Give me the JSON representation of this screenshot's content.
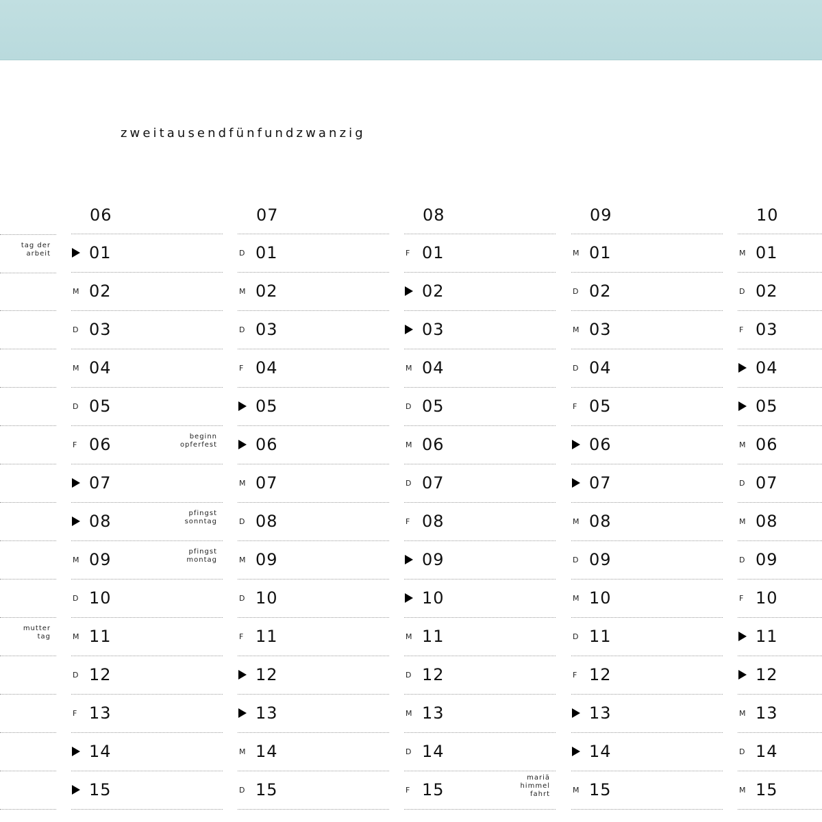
{
  "title": "zweitausendfünfundzwanzig",
  "left_column_notes": [
    "tag der\narbeit",
    "",
    "",
    "",
    "",
    "",
    "",
    "",
    "",
    "",
    "mutter\ntag",
    "",
    "",
    "",
    ""
  ],
  "months": [
    {
      "label": "06",
      "days": [
        {
          "wd": "▶",
          "num": "01",
          "note": ""
        },
        {
          "wd": "M",
          "num": "02",
          "note": ""
        },
        {
          "wd": "D",
          "num": "03",
          "note": ""
        },
        {
          "wd": "M",
          "num": "04",
          "note": ""
        },
        {
          "wd": "D",
          "num": "05",
          "note": ""
        },
        {
          "wd": "F",
          "num": "06",
          "note": "beginn\nopferfest"
        },
        {
          "wd": "▶",
          "num": "07",
          "note": ""
        },
        {
          "wd": "▶",
          "num": "08",
          "note": "pfingst\nsonntag"
        },
        {
          "wd": "M",
          "num": "09",
          "note": "pfingst\nmontag"
        },
        {
          "wd": "D",
          "num": "10",
          "note": ""
        },
        {
          "wd": "M",
          "num": "11",
          "note": ""
        },
        {
          "wd": "D",
          "num": "12",
          "note": ""
        },
        {
          "wd": "F",
          "num": "13",
          "note": ""
        },
        {
          "wd": "▶",
          "num": "14",
          "note": ""
        },
        {
          "wd": "▶",
          "num": "15",
          "note": ""
        }
      ]
    },
    {
      "label": "07",
      "days": [
        {
          "wd": "D",
          "num": "01",
          "note": ""
        },
        {
          "wd": "M",
          "num": "02",
          "note": ""
        },
        {
          "wd": "D",
          "num": "03",
          "note": ""
        },
        {
          "wd": "F",
          "num": "04",
          "note": ""
        },
        {
          "wd": "▶",
          "num": "05",
          "note": ""
        },
        {
          "wd": "▶",
          "num": "06",
          "note": ""
        },
        {
          "wd": "M",
          "num": "07",
          "note": ""
        },
        {
          "wd": "D",
          "num": "08",
          "note": ""
        },
        {
          "wd": "M",
          "num": "09",
          "note": ""
        },
        {
          "wd": "D",
          "num": "10",
          "note": ""
        },
        {
          "wd": "F",
          "num": "11",
          "note": ""
        },
        {
          "wd": "▶",
          "num": "12",
          "note": ""
        },
        {
          "wd": "▶",
          "num": "13",
          "note": ""
        },
        {
          "wd": "M",
          "num": "14",
          "note": ""
        },
        {
          "wd": "D",
          "num": "15",
          "note": ""
        }
      ]
    },
    {
      "label": "08",
      "days": [
        {
          "wd": "F",
          "num": "01",
          "note": ""
        },
        {
          "wd": "▶",
          "num": "02",
          "note": ""
        },
        {
          "wd": "▶",
          "num": "03",
          "note": ""
        },
        {
          "wd": "M",
          "num": "04",
          "note": ""
        },
        {
          "wd": "D",
          "num": "05",
          "note": ""
        },
        {
          "wd": "M",
          "num": "06",
          "note": ""
        },
        {
          "wd": "D",
          "num": "07",
          "note": ""
        },
        {
          "wd": "F",
          "num": "08",
          "note": ""
        },
        {
          "wd": "▶",
          "num": "09",
          "note": ""
        },
        {
          "wd": "▶",
          "num": "10",
          "note": ""
        },
        {
          "wd": "M",
          "num": "11",
          "note": ""
        },
        {
          "wd": "D",
          "num": "12",
          "note": ""
        },
        {
          "wd": "M",
          "num": "13",
          "note": ""
        },
        {
          "wd": "D",
          "num": "14",
          "note": ""
        },
        {
          "wd": "F",
          "num": "15",
          "note": "mariä\nhimmel\nfahrt"
        }
      ]
    },
    {
      "label": "09",
      "days": [
        {
          "wd": "M",
          "num": "01",
          "note": ""
        },
        {
          "wd": "D",
          "num": "02",
          "note": ""
        },
        {
          "wd": "M",
          "num": "03",
          "note": ""
        },
        {
          "wd": "D",
          "num": "04",
          "note": ""
        },
        {
          "wd": "F",
          "num": "05",
          "note": ""
        },
        {
          "wd": "▶",
          "num": "06",
          "note": ""
        },
        {
          "wd": "▶",
          "num": "07",
          "note": ""
        },
        {
          "wd": "M",
          "num": "08",
          "note": ""
        },
        {
          "wd": "D",
          "num": "09",
          "note": ""
        },
        {
          "wd": "M",
          "num": "10",
          "note": ""
        },
        {
          "wd": "D",
          "num": "11",
          "note": ""
        },
        {
          "wd": "F",
          "num": "12",
          "note": ""
        },
        {
          "wd": "▶",
          "num": "13",
          "note": ""
        },
        {
          "wd": "▶",
          "num": "14",
          "note": ""
        },
        {
          "wd": "M",
          "num": "15",
          "note": ""
        }
      ]
    },
    {
      "label": "10",
      "days": [
        {
          "wd": "M",
          "num": "01",
          "note": ""
        },
        {
          "wd": "D",
          "num": "02",
          "note": ""
        },
        {
          "wd": "F",
          "num": "03",
          "note": ""
        },
        {
          "wd": "▶",
          "num": "04",
          "note": ""
        },
        {
          "wd": "▶",
          "num": "05",
          "note": ""
        },
        {
          "wd": "M",
          "num": "06",
          "note": ""
        },
        {
          "wd": "D",
          "num": "07",
          "note": ""
        },
        {
          "wd": "M",
          "num": "08",
          "note": ""
        },
        {
          "wd": "D",
          "num": "09",
          "note": ""
        },
        {
          "wd": "F",
          "num": "10",
          "note": ""
        },
        {
          "wd": "▶",
          "num": "11",
          "note": ""
        },
        {
          "wd": "▶",
          "num": "12",
          "note": ""
        },
        {
          "wd": "M",
          "num": "13",
          "note": ""
        },
        {
          "wd": "D",
          "num": "14",
          "note": ""
        },
        {
          "wd": "M",
          "num": "15",
          "note": ""
        }
      ]
    }
  ]
}
